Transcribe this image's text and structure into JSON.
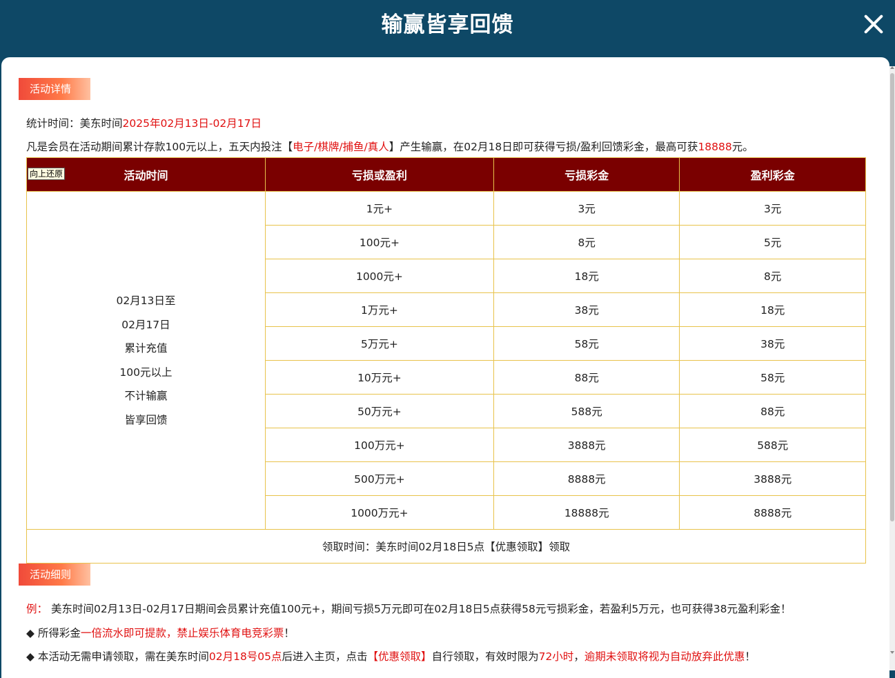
{
  "header": {
    "title": "输赢皆享回馈"
  },
  "sections": {
    "details_tag": "活动详情",
    "rules_tag": "活动细则"
  },
  "stats": {
    "label": "统计时间：美东时间",
    "range": "2025年02月13日-02月17日"
  },
  "intro": {
    "p1": "凡是会员在活动期间累计存款100元以上，五天内投注【",
    "games": "电子/棋牌/捕鱼/真人",
    "p2": "】产生输赢，在02月18日即可获得亏损/盈利回馈彩金，最高可获",
    "max": "18888",
    "p3": "元。"
  },
  "table": {
    "restore_button": "向上还原",
    "headers": [
      "活动时间",
      "亏损或盈利",
      "亏损彩金",
      "盈利彩金"
    ],
    "period_lines": [
      "02月13日至",
      "02月17日",
      "累计充值",
      "100元以上",
      "不计输赢",
      "皆享回馈"
    ],
    "rows": [
      [
        "1元+",
        "3元",
        "3元"
      ],
      [
        "100元+",
        "8元",
        "5元"
      ],
      [
        "1000元+",
        "18元",
        "8元"
      ],
      [
        "1万元+",
        "38元",
        "18元"
      ],
      [
        "5万元+",
        "58元",
        "38元"
      ],
      [
        "10万元+",
        "88元",
        "58元"
      ],
      [
        "50万元+",
        "588元",
        "88元"
      ],
      [
        "100万元+",
        "3888元",
        "588元"
      ],
      [
        "500万元+",
        "8888元",
        "3888元"
      ],
      [
        "1000万元+",
        "18888元",
        "8888元"
      ]
    ],
    "footer": "领取时间：美东时间02月18日5点【优惠领取】领取"
  },
  "rules": {
    "example_label": "例：",
    "example_text": "美东时间02月13日-02月17日期间会员累计充值100元+，期间亏损5万元即可在02月18日5点获得58元亏损彩金，若盈利5万元，也可获得38元盈利彩金！",
    "r1_a": "◆ 所得彩金",
    "r1_b": "一倍流水即可提款，禁止娱乐体育电竞彩票",
    "r1_c": "！",
    "r2_a": "◆ 本活动无需申请领取，需在美东时间",
    "r2_b": "02月18号05点",
    "r2_c": "后进入主页，点击",
    "r2_d": "【优惠领取】",
    "r2_e": "自行领取，有效时限为",
    "r2_f": "72小时",
    "r2_g": "，",
    "r2_h": "逾期未领取将视为自动放弃此优惠",
    "r2_i": "！"
  },
  "colors": {
    "header_bg": "#0e4866",
    "table_header_bg": "#7a0000",
    "table_border": "#e8c24a",
    "highlight": "#e01010"
  }
}
